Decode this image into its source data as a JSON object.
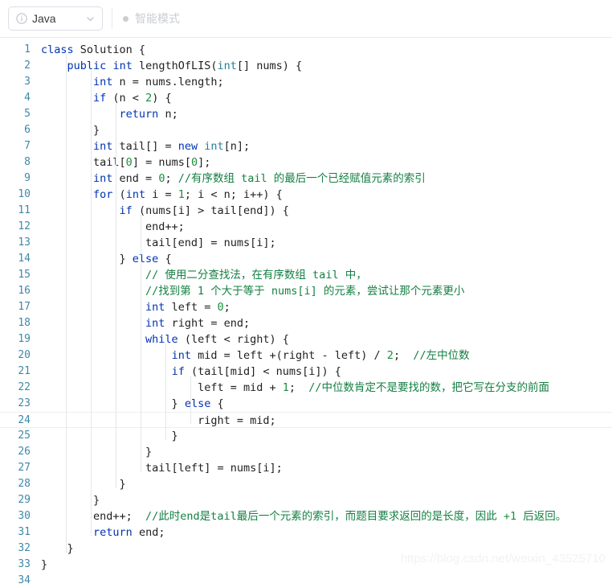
{
  "toolbar": {
    "language_label": "Java",
    "info_icon": "info-circle-icon",
    "chevron_icon": "chevron-down-icon",
    "smart_mode_label": "智能模式",
    "smart_mode_dot": "status-dot-icon"
  },
  "editor": {
    "active_line": 24,
    "watermark": "https://blog.csdn.net/weixin_43525710",
    "colors": {
      "keyword": "#0033b3",
      "type": "#267f99",
      "number": "#1a8f3c",
      "comment": "#158043",
      "plain": "#1f1f1f",
      "line_number": "#3f88a8",
      "active_line_border": "#eceef0",
      "indent_guide": "#e4e6e8"
    },
    "lines": [
      {
        "n": 1,
        "indent": 0,
        "tokens": [
          [
            "kw",
            "class"
          ],
          [
            "pln",
            " Solution {"
          ]
        ]
      },
      {
        "n": 2,
        "indent": 1,
        "tokens": [
          [
            "pln",
            "    "
          ],
          [
            "kw",
            "public"
          ],
          [
            "pln",
            " "
          ],
          [
            "kw",
            "int"
          ],
          [
            "pln",
            " lengthOfLIS("
          ],
          [
            "typ",
            "int"
          ],
          [
            "pln",
            "[] nums) {"
          ]
        ]
      },
      {
        "n": 3,
        "indent": 2,
        "tokens": [
          [
            "pln",
            "        "
          ],
          [
            "kw",
            "int"
          ],
          [
            "pln",
            " n = nums.length;"
          ]
        ]
      },
      {
        "n": 4,
        "indent": 2,
        "tokens": [
          [
            "pln",
            "        "
          ],
          [
            "kw",
            "if"
          ],
          [
            "pln",
            " (n < "
          ],
          [
            "num",
            "2"
          ],
          [
            "pln",
            ") {"
          ]
        ]
      },
      {
        "n": 5,
        "indent": 3,
        "tokens": [
          [
            "pln",
            "            "
          ],
          [
            "kw",
            "return"
          ],
          [
            "pln",
            " n;"
          ]
        ]
      },
      {
        "n": 6,
        "indent": 2,
        "tokens": [
          [
            "pln",
            "        }"
          ]
        ]
      },
      {
        "n": 7,
        "indent": 2,
        "tokens": [
          [
            "pln",
            "        "
          ],
          [
            "kw",
            "int"
          ],
          [
            "pln",
            " tail[] = "
          ],
          [
            "kw",
            "new"
          ],
          [
            "pln",
            " "
          ],
          [
            "typ",
            "int"
          ],
          [
            "pln",
            "[n];"
          ]
        ]
      },
      {
        "n": 8,
        "indent": 2,
        "tokens": [
          [
            "pln",
            "        tail["
          ],
          [
            "num",
            "0"
          ],
          [
            "pln",
            "] = nums["
          ],
          [
            "num",
            "0"
          ],
          [
            "pln",
            "];"
          ]
        ]
      },
      {
        "n": 9,
        "indent": 2,
        "tokens": [
          [
            "pln",
            "        "
          ],
          [
            "kw",
            "int"
          ],
          [
            "pln",
            " end = "
          ],
          [
            "num",
            "0"
          ],
          [
            "pln",
            "; "
          ],
          [
            "cmt",
            "//有序数组 tail 的最后一个已经赋值元素的索引"
          ]
        ]
      },
      {
        "n": 10,
        "indent": 2,
        "tokens": [
          [
            "pln",
            "        "
          ],
          [
            "kw",
            "for"
          ],
          [
            "pln",
            " ("
          ],
          [
            "kw",
            "int"
          ],
          [
            "pln",
            " i = "
          ],
          [
            "num",
            "1"
          ],
          [
            "pln",
            "; i < n; i++) {"
          ]
        ]
      },
      {
        "n": 11,
        "indent": 3,
        "tokens": [
          [
            "pln",
            "            "
          ],
          [
            "kw",
            "if"
          ],
          [
            "pln",
            " (nums[i] > tail[end]) {"
          ]
        ]
      },
      {
        "n": 12,
        "indent": 4,
        "tokens": [
          [
            "pln",
            "                end++;"
          ]
        ]
      },
      {
        "n": 13,
        "indent": 4,
        "tokens": [
          [
            "pln",
            "                tail[end] = nums[i];"
          ]
        ]
      },
      {
        "n": 14,
        "indent": 3,
        "tokens": [
          [
            "pln",
            "            } "
          ],
          [
            "kw",
            "else"
          ],
          [
            "pln",
            " {"
          ]
        ]
      },
      {
        "n": 15,
        "indent": 4,
        "tokens": [
          [
            "pln",
            "                "
          ],
          [
            "cmt",
            "// 使用二分查找法，在有序数组 tail 中，"
          ]
        ]
      },
      {
        "n": 16,
        "indent": 4,
        "tokens": [
          [
            "pln",
            "                "
          ],
          [
            "cmt",
            "//找到第 1 个大于等于 nums[i] 的元素，尝试让那个元素更小"
          ]
        ]
      },
      {
        "n": 17,
        "indent": 4,
        "tokens": [
          [
            "pln",
            "                "
          ],
          [
            "kw",
            "int"
          ],
          [
            "pln",
            " left = "
          ],
          [
            "num",
            "0"
          ],
          [
            "pln",
            ";"
          ]
        ]
      },
      {
        "n": 18,
        "indent": 4,
        "tokens": [
          [
            "pln",
            "                "
          ],
          [
            "kw",
            "int"
          ],
          [
            "pln",
            " right = end;"
          ]
        ]
      },
      {
        "n": 19,
        "indent": 4,
        "tokens": [
          [
            "pln",
            "                "
          ],
          [
            "kw",
            "while"
          ],
          [
            "pln",
            " (left < right) {"
          ]
        ]
      },
      {
        "n": 20,
        "indent": 5,
        "tokens": [
          [
            "pln",
            "                    "
          ],
          [
            "kw",
            "int"
          ],
          [
            "pln",
            " mid = left +(right - left) / "
          ],
          [
            "num",
            "2"
          ],
          [
            "pln",
            ";  "
          ],
          [
            "cmt",
            "//左中位数"
          ]
        ]
      },
      {
        "n": 21,
        "indent": 5,
        "tokens": [
          [
            "pln",
            "                    "
          ],
          [
            "kw",
            "if"
          ],
          [
            "pln",
            " (tail[mid] < nums[i]) {"
          ]
        ]
      },
      {
        "n": 22,
        "indent": 6,
        "tokens": [
          [
            "pln",
            "                        left = mid + "
          ],
          [
            "num",
            "1"
          ],
          [
            "pln",
            ";  "
          ],
          [
            "cmt",
            "//中位数肯定不是要找的数，把它写在分支的前面"
          ]
        ]
      },
      {
        "n": 23,
        "indent": 5,
        "tokens": [
          [
            "pln",
            "                    } "
          ],
          [
            "kw",
            "else"
          ],
          [
            "pln",
            " {"
          ]
        ]
      },
      {
        "n": 24,
        "indent": 6,
        "tokens": [
          [
            "pln",
            "                        right = mid;"
          ]
        ]
      },
      {
        "n": 25,
        "indent": 5,
        "tokens": [
          [
            "pln",
            "                    }"
          ]
        ]
      },
      {
        "n": 26,
        "indent": 4,
        "tokens": [
          [
            "pln",
            "                }"
          ]
        ]
      },
      {
        "n": 27,
        "indent": 4,
        "tokens": [
          [
            "pln",
            "                tail[left] = nums[i];"
          ]
        ]
      },
      {
        "n": 28,
        "indent": 3,
        "tokens": [
          [
            "pln",
            "            }"
          ]
        ]
      },
      {
        "n": 29,
        "indent": 2,
        "tokens": [
          [
            "pln",
            "        }"
          ]
        ]
      },
      {
        "n": 30,
        "indent": 2,
        "tokens": [
          [
            "pln",
            "        end++;  "
          ],
          [
            "cmt",
            "//此时end是tail最后一个元素的索引，而题目要求返回的是长度，因此 "
          ],
          [
            "num",
            "+1"
          ],
          [
            "cmt",
            " 后返回。"
          ]
        ]
      },
      {
        "n": 31,
        "indent": 2,
        "tokens": [
          [
            "pln",
            "        "
          ],
          [
            "kw",
            "return"
          ],
          [
            "pln",
            " end;"
          ]
        ]
      },
      {
        "n": 32,
        "indent": 1,
        "tokens": [
          [
            "pln",
            "    }"
          ]
        ]
      },
      {
        "n": 33,
        "indent": 0,
        "tokens": [
          [
            "pln",
            "}"
          ]
        ]
      },
      {
        "n": 34,
        "indent": 0,
        "tokens": [
          [
            "pln",
            ""
          ]
        ]
      }
    ]
  }
}
